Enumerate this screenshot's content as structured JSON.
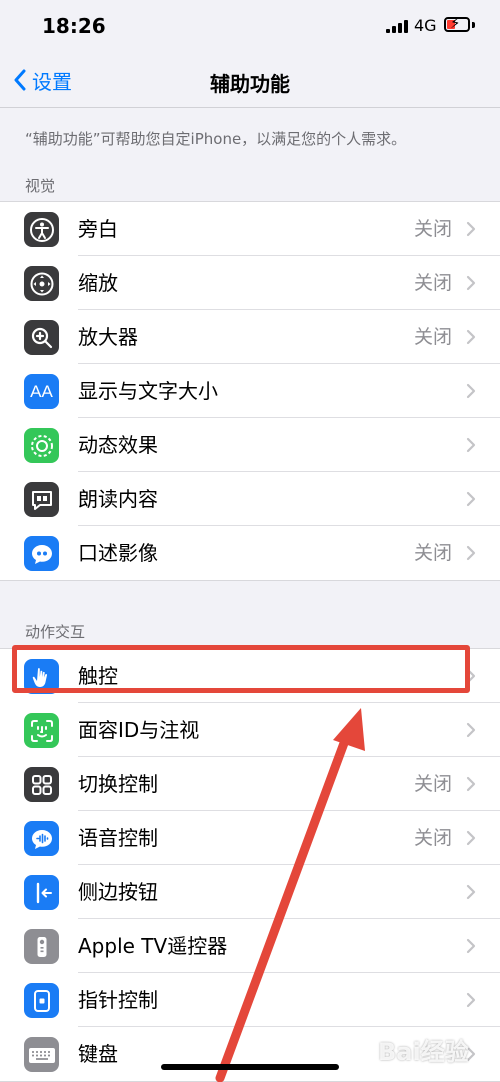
{
  "status_bar": {
    "time": "18:26",
    "network": "4G"
  },
  "nav": {
    "back_label": "设置",
    "title": "辅助功能"
  },
  "description": "“辅助功能”可帮助您自定iPhone，以满足您的个人需求。",
  "sections": [
    {
      "header": "视觉",
      "rows": [
        {
          "label": "旁白",
          "value": "关闭",
          "icon": "voiceover-icon",
          "color": "#3a3a3c"
        },
        {
          "label": "缩放",
          "value": "关闭",
          "icon": "zoom-icon",
          "color": "#3a3a3c"
        },
        {
          "label": "放大器",
          "value": "关闭",
          "icon": "magnifier-icon",
          "color": "#3a3a3c"
        },
        {
          "label": "显示与文字大小",
          "value": "",
          "icon": "text-size-icon",
          "color": "#1a7cf5"
        },
        {
          "label": "动态效果",
          "value": "",
          "icon": "motion-icon",
          "color": "#34c759"
        },
        {
          "label": "朗读内容",
          "value": "",
          "icon": "spoken-content-icon",
          "color": "#3a3a3c"
        },
        {
          "label": "口述影像",
          "value": "关闭",
          "icon": "audio-description-icon",
          "color": "#1a7cf5"
        }
      ]
    },
    {
      "header": "动作交互",
      "rows": [
        {
          "label": "触控",
          "value": "",
          "icon": "touch-hand-icon",
          "color": "#1a7cf5"
        },
        {
          "label": "面容ID与注视",
          "value": "",
          "icon": "face-id-icon",
          "color": "#34c759"
        },
        {
          "label": "切换控制",
          "value": "关闭",
          "icon": "switch-control-icon",
          "color": "#3a3a3c"
        },
        {
          "label": "语音控制",
          "value": "关闭",
          "icon": "voice-control-icon",
          "color": "#1a7cf5"
        },
        {
          "label": "侧边按钮",
          "value": "",
          "icon": "side-button-icon",
          "color": "#1a7cf5"
        },
        {
          "label": "Apple TV遥控器",
          "value": "",
          "icon": "tv-remote-icon",
          "color": "#8e8e93"
        },
        {
          "label": "指针控制",
          "value": "",
          "icon": "pointer-control-icon",
          "color": "#1a7cf5"
        },
        {
          "label": "键盘",
          "value": "",
          "icon": "keyboard-icon",
          "color": "#8e8e93"
        }
      ]
    }
  ],
  "watermark": "Bai经验",
  "colors": {
    "accent": "#007aff",
    "annotation": "#e4473a",
    "background": "#f2f2f7"
  }
}
